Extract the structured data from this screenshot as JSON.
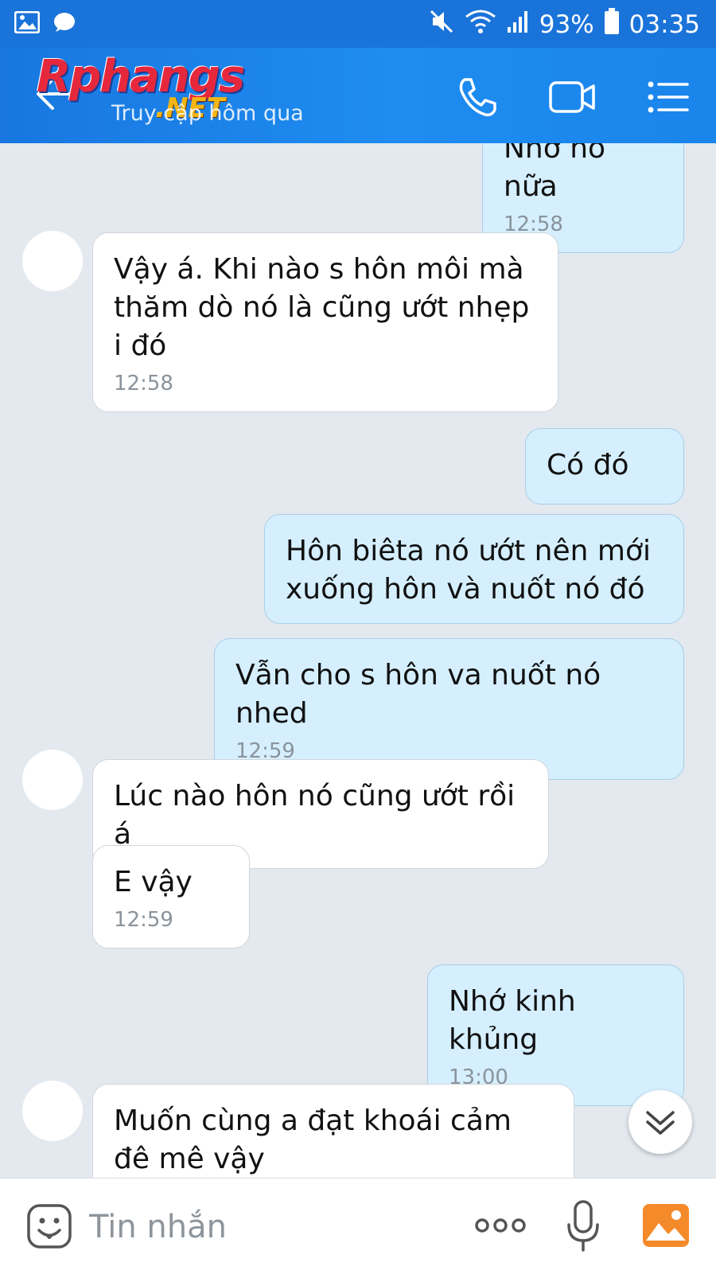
{
  "status_bar": {
    "battery": "93%",
    "time": "03:35"
  },
  "header": {
    "logo": "Rphangs",
    "logo_suffix": ".NET",
    "last_seen": "Truy cập hôm qua"
  },
  "messages": [
    {
      "dir": "out",
      "text": "Nhớ nó nữa",
      "time": "12:58"
    },
    {
      "dir": "in",
      "text": "Vậy á. Khi nào s hôn môi mà thăm dò nó là cũng ướt nhẹp i đó",
      "time": "12:58"
    },
    {
      "dir": "out",
      "text": "Có đó",
      "time": ""
    },
    {
      "dir": "out",
      "text": " Hôn biêta  nó ướt nên mới xuống hôn và nuốt nó đó",
      "time": ""
    },
    {
      "dir": "out",
      "text": "Vẫn cho s hôn va nuốt nó nhed",
      "time": "12:59"
    },
    {
      "dir": "in",
      "text": "Lúc nào hôn nó cũng ướt rồi á",
      "time": ""
    },
    {
      "dir": "in",
      "text": "E vậy",
      "time": "12:59"
    },
    {
      "dir": "out",
      "text": "Nhớ kinh khủng",
      "time": "13:00"
    },
    {
      "dir": "in",
      "text": "Muốn cùng a đạt khoái cảm đê mê vậy",
      "time": ""
    }
  ],
  "input": {
    "placeholder": "Tin nhắn"
  },
  "icons": {
    "back": "back-arrow-icon",
    "call": "phone-icon",
    "video": "video-camera-icon",
    "menu": "menu-icon",
    "emoji": "emoji-icon",
    "more": "more-dots-icon",
    "mic": "microphone-icon",
    "photo": "photo-gallery-icon",
    "scroll": "double-chevron-down-icon"
  },
  "colors": {
    "header": "#1e88ee",
    "outgoing_bubble": "#d5efff",
    "incoming_bubble": "#ffffff",
    "chat_background": "#e3e9ef",
    "photo_button": "#f58a2a"
  }
}
